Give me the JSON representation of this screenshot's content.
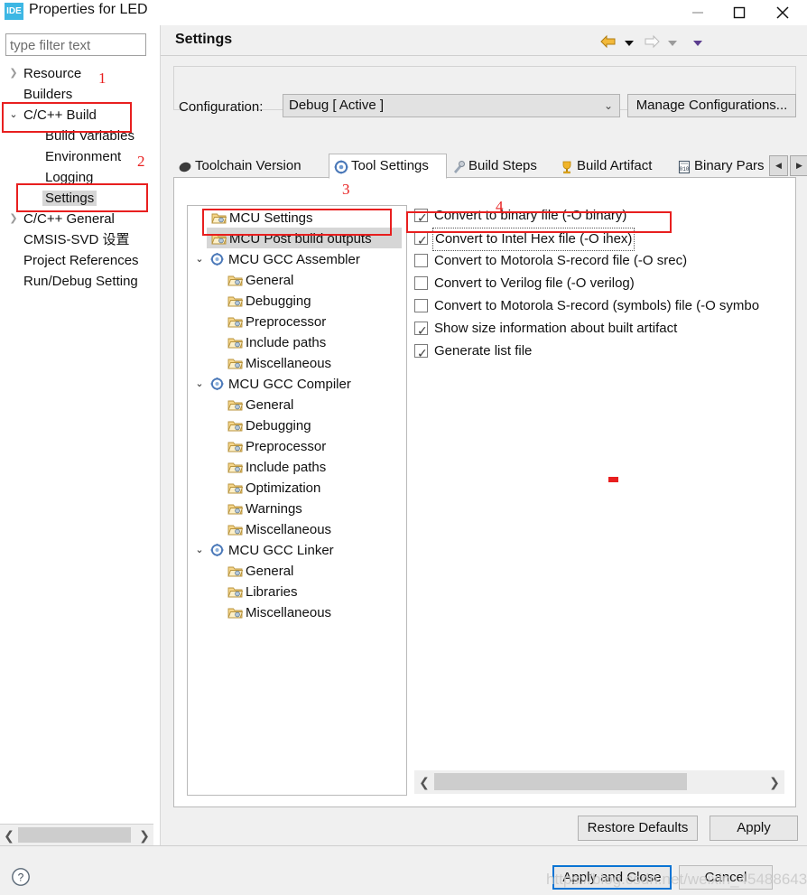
{
  "window": {
    "title": "Properties for LED",
    "app_icon_label": "IDE",
    "controls": {
      "minimize": "minimize-icon",
      "maximize": "maximize-icon",
      "close": "close-icon"
    }
  },
  "filter": {
    "placeholder": "type filter text",
    "value": ""
  },
  "sidebar": {
    "items": [
      {
        "label": "Resource",
        "indent": 0,
        "arrow": "collapsed",
        "selected": false
      },
      {
        "label": "Builders",
        "indent": 0,
        "arrow": "none",
        "selected": false
      },
      {
        "label": "C/C++ Build",
        "indent": 0,
        "arrow": "expanded",
        "selected": false
      },
      {
        "label": "Build Variables",
        "indent": 1,
        "arrow": "none",
        "selected": false
      },
      {
        "label": "Environment",
        "indent": 1,
        "arrow": "none",
        "selected": false
      },
      {
        "label": "Logging",
        "indent": 1,
        "arrow": "none",
        "selected": false
      },
      {
        "label": "Settings",
        "indent": 1,
        "arrow": "none",
        "selected": true
      },
      {
        "label": "C/C++ General",
        "indent": 0,
        "arrow": "collapsed",
        "selected": false
      },
      {
        "label": "CMSIS-SVD 设置",
        "indent": 0,
        "arrow": "none",
        "selected": false
      },
      {
        "label": "Project References",
        "indent": 0,
        "arrow": "none",
        "selected": false
      },
      {
        "label": "Run/Debug Setting",
        "indent": 0,
        "arrow": "none",
        "selected": false
      }
    ]
  },
  "page": {
    "title": "Settings",
    "nav": {
      "back": "back-arrow-icon",
      "back_menu": "chevron-down-icon",
      "forward": "forward-arrow-icon",
      "forward_menu": "chevron-down-icon",
      "view_menu": "chevron-down-icon"
    }
  },
  "configuration": {
    "label": "Configuration:",
    "selected": "Debug  [ Active ]",
    "options": [
      "Debug  [ Active ]"
    ],
    "manage_button": "Manage Configurations..."
  },
  "tabs": {
    "items": [
      {
        "label": "Toolchain Version",
        "icon": "toolchain-icon",
        "active": false
      },
      {
        "label": "Tool Settings",
        "icon": "tool-settings-icon",
        "active": true
      },
      {
        "label": "Build Steps",
        "icon": "build-steps-icon",
        "active": false
      },
      {
        "label": "Build Artifact",
        "icon": "build-artifact-icon",
        "active": false
      },
      {
        "label": "Binary Pars",
        "icon": "binary-parser-icon",
        "active": false
      }
    ],
    "scroll_left": "◀",
    "scroll_right": "▶"
  },
  "settings_tree": {
    "items": [
      {
        "label": "MCU Settings",
        "indent": 1,
        "arrow": "none",
        "selected": false
      },
      {
        "label": "MCU Post build outputs",
        "indent": 1,
        "arrow": "none",
        "selected": true
      },
      {
        "label": "MCU GCC Assembler",
        "indent": 0,
        "arrow": "expanded",
        "selected": false,
        "icon": "gear-folder-icon"
      },
      {
        "label": "General",
        "indent": 2,
        "arrow": "none",
        "selected": false
      },
      {
        "label": "Debugging",
        "indent": 2,
        "arrow": "none",
        "selected": false
      },
      {
        "label": "Preprocessor",
        "indent": 2,
        "arrow": "none",
        "selected": false
      },
      {
        "label": "Include paths",
        "indent": 2,
        "arrow": "none",
        "selected": false
      },
      {
        "label": "Miscellaneous",
        "indent": 2,
        "arrow": "none",
        "selected": false
      },
      {
        "label": "MCU GCC Compiler",
        "indent": 0,
        "arrow": "expanded",
        "selected": false,
        "icon": "gear-folder-icon"
      },
      {
        "label": "General",
        "indent": 2,
        "arrow": "none",
        "selected": false
      },
      {
        "label": "Debugging",
        "indent": 2,
        "arrow": "none",
        "selected": false
      },
      {
        "label": "Preprocessor",
        "indent": 2,
        "arrow": "none",
        "selected": false
      },
      {
        "label": "Include paths",
        "indent": 2,
        "arrow": "none",
        "selected": false
      },
      {
        "label": "Optimization",
        "indent": 2,
        "arrow": "none",
        "selected": false
      },
      {
        "label": "Warnings",
        "indent": 2,
        "arrow": "none",
        "selected": false
      },
      {
        "label": "Miscellaneous",
        "indent": 2,
        "arrow": "none",
        "selected": false
      },
      {
        "label": "MCU GCC Linker",
        "indent": 0,
        "arrow": "expanded",
        "selected": false,
        "icon": "gear-folder-icon"
      },
      {
        "label": "General",
        "indent": 2,
        "arrow": "none",
        "selected": false
      },
      {
        "label": "Libraries",
        "indent": 2,
        "arrow": "none",
        "selected": false
      },
      {
        "label": "Miscellaneous",
        "indent": 2,
        "arrow": "none",
        "selected": false
      }
    ]
  },
  "options": {
    "checkboxes": [
      {
        "label": "Convert to binary file (-O binary)",
        "checked": true,
        "focused": false
      },
      {
        "label": "Convert to Intel Hex file (-O ihex)",
        "checked": true,
        "focused": true
      },
      {
        "label": "Convert to Motorola S-record file (-O srec)",
        "checked": false,
        "focused": false
      },
      {
        "label": "Convert to Verilog file (-O verilog)",
        "checked": false,
        "focused": false
      },
      {
        "label": "Convert to Motorola S-record (symbols) file (-O symbo",
        "checked": false,
        "focused": false
      },
      {
        "label": "Show size information about built artifact",
        "checked": true,
        "focused": false
      },
      {
        "label": "Generate list file",
        "checked": true,
        "focused": false
      }
    ]
  },
  "buttons": {
    "restore_defaults": "Restore Defaults",
    "apply": "Apply",
    "apply_and_close": "Apply and Close",
    "cancel": "Cancel",
    "help": "help-icon"
  },
  "annotations": {
    "numbers": [
      "1",
      "2",
      "3",
      "4"
    ],
    "color": "#e81f1f"
  },
  "watermark": {
    "text": "https://blog.csdn.net/weixin_45488643"
  }
}
